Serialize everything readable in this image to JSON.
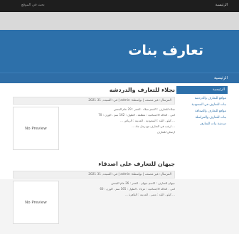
{
  "topbar": {
    "brand": "الرئيسية",
    "search": "بحث في الموقع"
  },
  "site": {
    "title": "تعارف بنات"
  },
  "nav": {
    "home": "الرئيسية"
  },
  "sidebar": {
    "heading": "الرئيسية",
    "items": [
      "مواقع للتعارف والدردشة",
      "بنات للتعارف في السعودية",
      "مواقع للتعارف والصداقة",
      "بنات للتعارف والمراسلة",
      "دردشة بنات للتعارف"
    ]
  },
  "posts": [
    {
      "title": "نجلاء للتعارف والدردشه",
      "meta": "المرسال: غير مصنف | بواسطة: admin | في: السبت, 31 2021",
      "thumb": "No Preview",
      "lines": [
        "نجلاء للتعارف : الاسم نجلاء . العمر : 29 عام الجنس",
        "انثى . الحالة الاجتماعية : مطلقة . الطول : 162 سم . الوزن : 70",
        "... كيلو . البلد : السعودية . المدينة : الرياض ...",
        "... ارغب في التعارف مع رجل جاد ...",
        "ارسلي للتعارف"
      ]
    },
    {
      "title": "جيهان للتعارف على اصدقاء",
      "meta": "المرسال: غير مصنف | بواسطة: admin | في: السبت, 31 2021",
      "thumb": "No Preview",
      "lines": [
        "جيهان للتعارف : الاسم جيهان . العمر : 26 عام الجنس",
        "انثى . الحالة الاجتماعية : عزباء . الطول : 165 سم . الوزن : 60",
        "... كيلو . البلد : مصر . المدينة : القاهرة ..."
      ]
    }
  ]
}
